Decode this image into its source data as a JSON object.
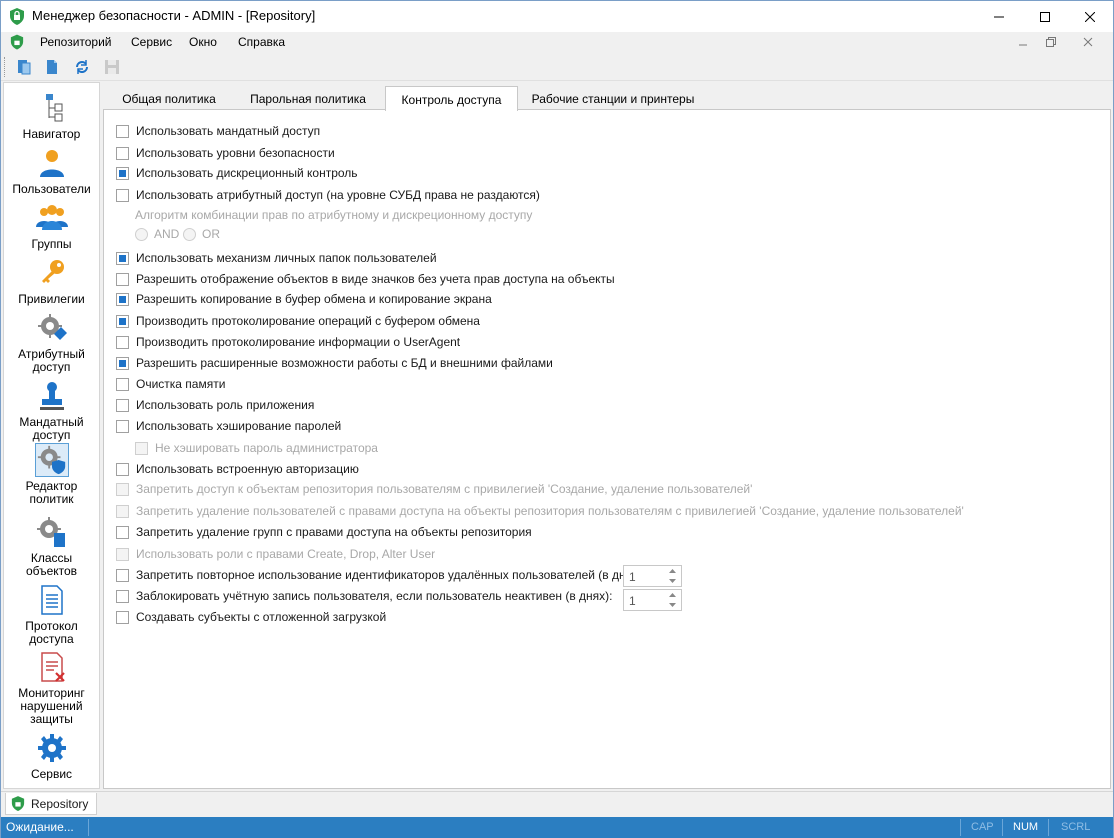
{
  "window": {
    "title": "Менеджер безопасности - ADMIN - [Repository]"
  },
  "menu": {
    "items": [
      "Репозиторий",
      "Сервис",
      "Окно",
      "Справка"
    ]
  },
  "toolbar": {
    "buttons": [
      "new-document-icon",
      "open-icon",
      "refresh-icon",
      "save-icon"
    ]
  },
  "navigator": {
    "items": [
      {
        "label": "Навигатор",
        "icon": "tree-icon"
      },
      {
        "label": "Пользователи",
        "icon": "user-icon"
      },
      {
        "label": "Группы",
        "icon": "group-icon"
      },
      {
        "label": "Привилегии",
        "icon": "key-icon"
      },
      {
        "label": "Атрибутный доступ",
        "icon": "gear-tag-icon"
      },
      {
        "label": "Мандатный доступ",
        "icon": "stamp-icon"
      },
      {
        "label": "Редактор политик",
        "icon": "gear-shield-icon"
      },
      {
        "label": "Классы объектов",
        "icon": "gear-document-icon"
      },
      {
        "label": "Протокол доступа",
        "icon": "log-icon"
      },
      {
        "label": "Мониторинг нарушений защиты",
        "icon": "violation-icon"
      },
      {
        "label": "Сервис",
        "icon": "service-gear-icon"
      }
    ],
    "active_index": 6
  },
  "tabs": {
    "items": [
      "Общая политика",
      "Парольная политика",
      "Контроль доступа",
      "Рабочие станции и принтеры"
    ],
    "active_index": 2
  },
  "options": {
    "mandatory_access": {
      "label": "Использовать мандатный доступ",
      "checked": false,
      "enabled": true
    },
    "security_levels": {
      "label": "Использовать уровни безопасности",
      "checked": false,
      "enabled": true
    },
    "discretionary_control": {
      "label": "Использовать дискреционный контроль",
      "checked": true,
      "enabled": true
    },
    "attribute_access": {
      "label": "Использовать атрибутный доступ (на уровне СУБД права не раздаются)",
      "checked": false,
      "enabled": true
    },
    "combination_algorithm": {
      "label": "Алгоритм комбинации прав по атрибутному и дискреционному доступу",
      "options": [
        "AND",
        "OR"
      ]
    },
    "personal_folders": {
      "label": "Использовать механизм личных папок пользователей",
      "checked": true,
      "enabled": true
    },
    "show_icons": {
      "label": "Разрешить отображение объектов в виде значков без учета прав доступа на объекты",
      "checked": false,
      "enabled": true
    },
    "clipboard_copy": {
      "label": "Разрешить копирование в буфер обмена и копирование экрана",
      "checked": true,
      "enabled": true
    },
    "clipboard_log": {
      "label": "Производить протоколирование операций с буфером обмена",
      "checked": true,
      "enabled": true
    },
    "useragent_log": {
      "label": "Производить протоколирование информации о UserAgent",
      "checked": false,
      "enabled": true
    },
    "db_files": {
      "label": "Разрешить расширенные возможности работы с БД и внешними файлами",
      "checked": true,
      "enabled": true
    },
    "memory_clear": {
      "label": "Очистка памяти",
      "checked": false,
      "enabled": true
    },
    "app_role": {
      "label": "Использовать роль приложения",
      "checked": false,
      "enabled": true
    },
    "password_hash": {
      "label": "Использовать хэширование паролей",
      "checked": false,
      "enabled": true
    },
    "no_admin_hash": {
      "label": "Не хэшировать пароль администратора",
      "checked": false,
      "enabled": false
    },
    "builtin_auth": {
      "label": "Использовать встроенную авторизацию",
      "checked": false,
      "enabled": true
    },
    "deny_repo_access": {
      "label": "Запретить доступ к объектам репозитория пользователям с привилегией 'Создание, удаление пользователей'",
      "checked": false,
      "enabled": false
    },
    "deny_user_delete": {
      "label": "Запретить удаление пользователей с правами доступа на объекты репозитория пользователям с привилегией 'Создание, удаление пользователей'",
      "checked": false,
      "enabled": false
    },
    "deny_group_delete": {
      "label": "Запретить удаление групп с правами доступа на объекты репозитория",
      "checked": false,
      "enabled": true
    },
    "roles_create": {
      "label": "Использовать роли с правами Create, Drop, Alter User",
      "checked": false,
      "enabled": false
    },
    "deny_id_reuse": {
      "label": "Запретить повторное использование идентификаторов удалённых пользователей (в днях):",
      "checked": false,
      "enabled": true,
      "value": "1"
    },
    "lock_inactive": {
      "label": "Заблокировать учётную запись пользователя, если пользователь неактивен (в днях):",
      "checked": false,
      "enabled": true,
      "value": "1"
    },
    "lazy_subjects": {
      "label": "Создавать субъекты с отложенной загрузкой",
      "checked": false,
      "enabled": true
    }
  },
  "document_tab": {
    "label": "Repository"
  },
  "statusbar": {
    "text": "Ожидание...",
    "indicators": [
      {
        "label": "CAP",
        "active": false
      },
      {
        "label": "NUM",
        "active": true
      },
      {
        "label": "SCRL",
        "active": false
      }
    ]
  },
  "colors": {
    "accent": "#1e73c8",
    "statusbar": "#2b7ec1"
  }
}
